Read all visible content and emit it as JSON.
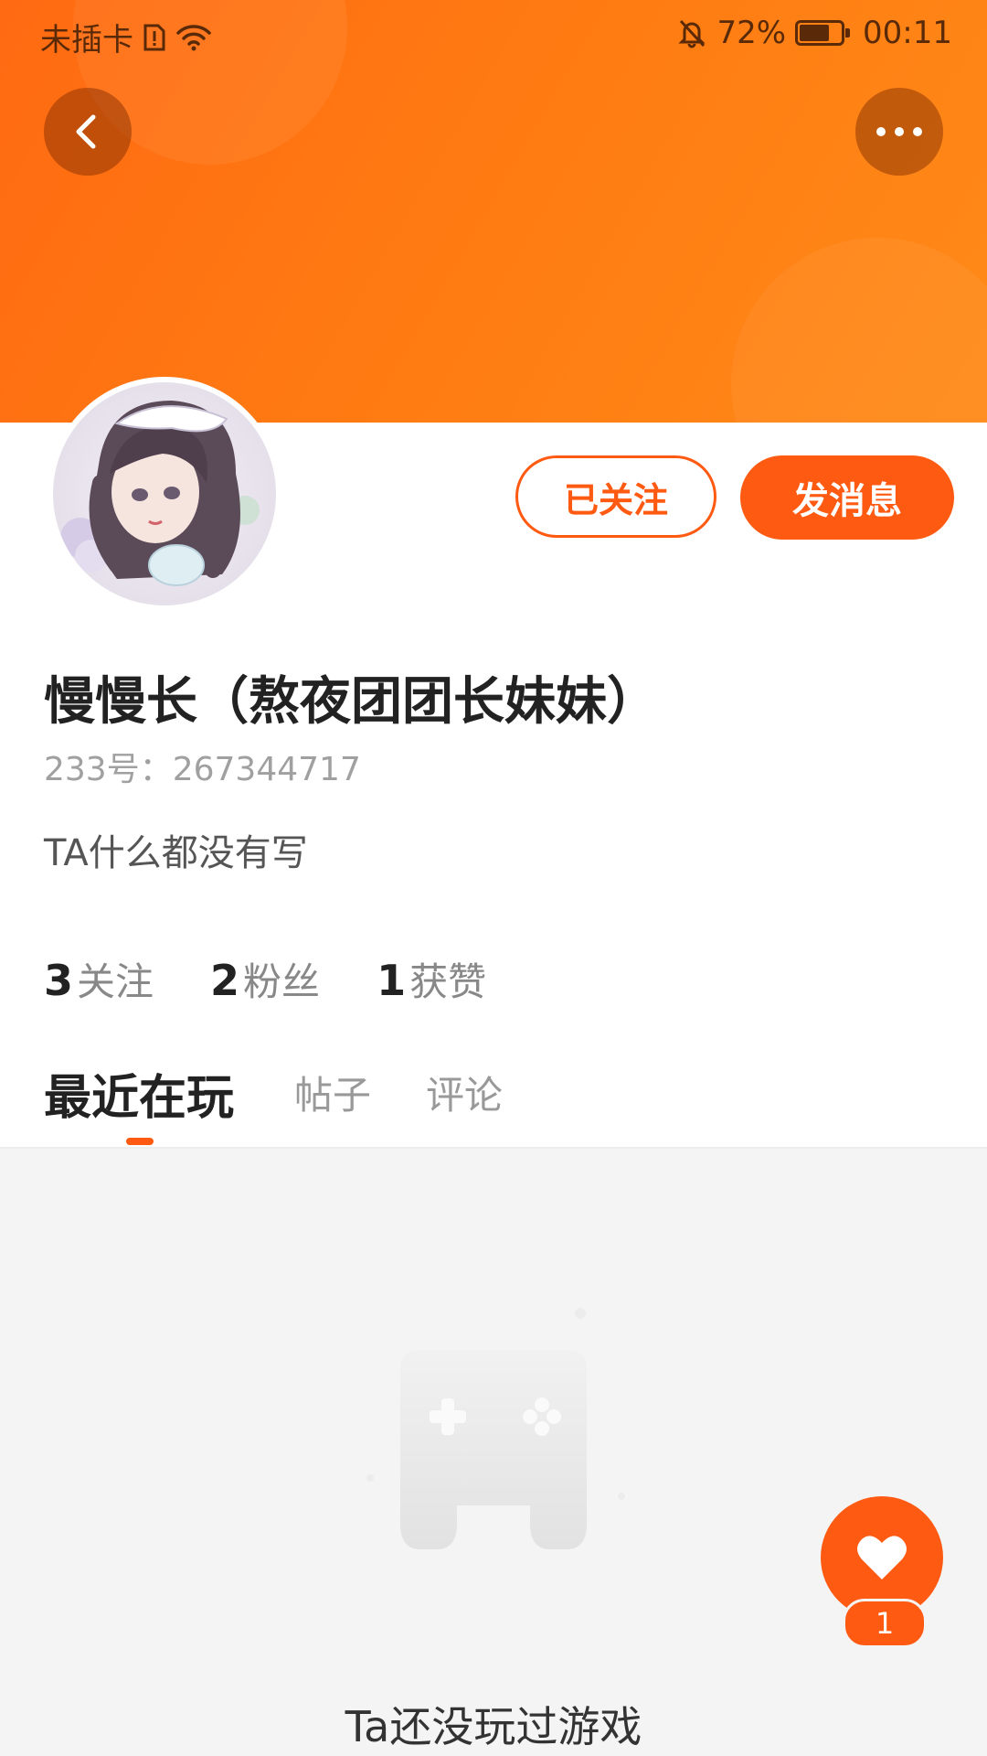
{
  "status_bar": {
    "carrier": "未插卡",
    "battery_percent": "72%",
    "battery_level": 0.72,
    "time": "00:11",
    "icons": [
      "sim-alert-icon",
      "wifi-icon",
      "mute-bell-icon",
      "battery-icon"
    ]
  },
  "header": {
    "back_icon": "chevron-left-icon",
    "more_icon": "more-dots-icon",
    "banner_color": "#ff7a12"
  },
  "profile": {
    "nickname": "慢慢长（熬夜团团长妹妹）",
    "user_id": "233号：267344717",
    "bio": "TA什么都没有写",
    "followed_label": "已关注",
    "message_label": "发消息",
    "stats": [
      {
        "num": "3",
        "label": "关注"
      },
      {
        "num": "2",
        "label": "粉丝"
      },
      {
        "num": "1",
        "label": "获赞"
      }
    ]
  },
  "tabs": [
    {
      "label": "最近在玩",
      "active": true
    },
    {
      "label": "帖子",
      "active": false
    },
    {
      "label": "评论",
      "active": false
    }
  ],
  "empty_state": {
    "icon": "gamepad-icon",
    "text": "Ta还没玩过游戏"
  },
  "like": {
    "icon": "heart-icon",
    "count": "1"
  },
  "colors": {
    "accent": "#ff5a12",
    "banner": "#ff7a12",
    "background": "#f4f4f4"
  }
}
